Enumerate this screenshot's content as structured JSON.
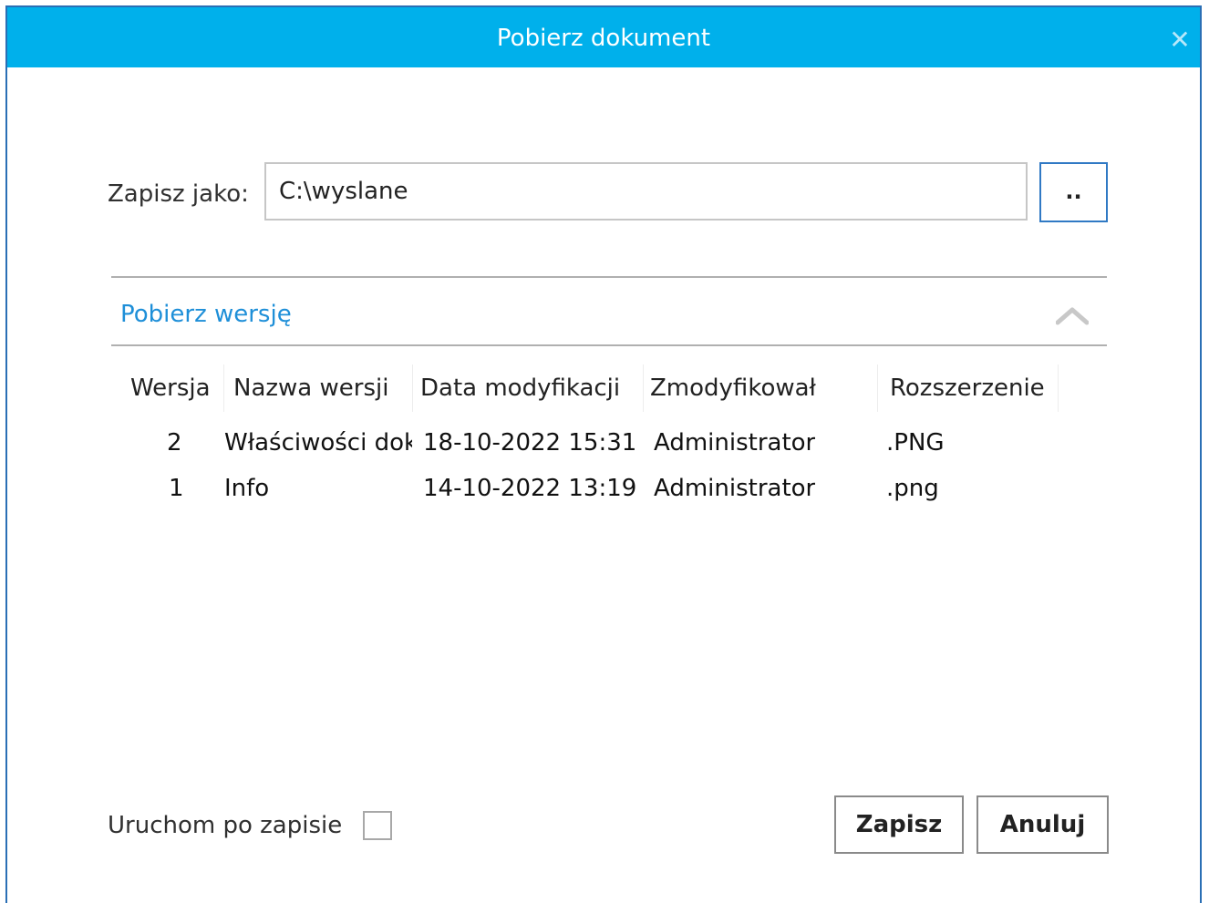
{
  "dialog": {
    "title": "Pobierz dokument",
    "close_icon": "close-icon",
    "title_color": "#00b0eb"
  },
  "save_as": {
    "label": "Zapisz jako:",
    "path_value": "C:\\wyslane",
    "browse_label": ".."
  },
  "versions": {
    "section_title": "Pobierz wersję",
    "collapse_icon": "chevron-up-icon",
    "columns": [
      "Wersja",
      "Nazwa wersji",
      "Data modyfikacji",
      "Zmodyfikował",
      "Rozszerzenie"
    ],
    "rows": [
      {
        "version": "2",
        "name": "Właściwości dok",
        "date": "18-10-2022 15:31",
        "modified_by": "Administrator",
        "extension": ".PNG"
      },
      {
        "version": "1",
        "name": "Info",
        "date": "14-10-2022 13:19",
        "modified_by": "Administrator",
        "extension": ".png"
      }
    ]
  },
  "footer": {
    "run_after_save_label": "Uruchom po zapisie",
    "run_after_save_checked": false,
    "save_button": "Zapisz",
    "cancel_button": "Anuluj"
  }
}
